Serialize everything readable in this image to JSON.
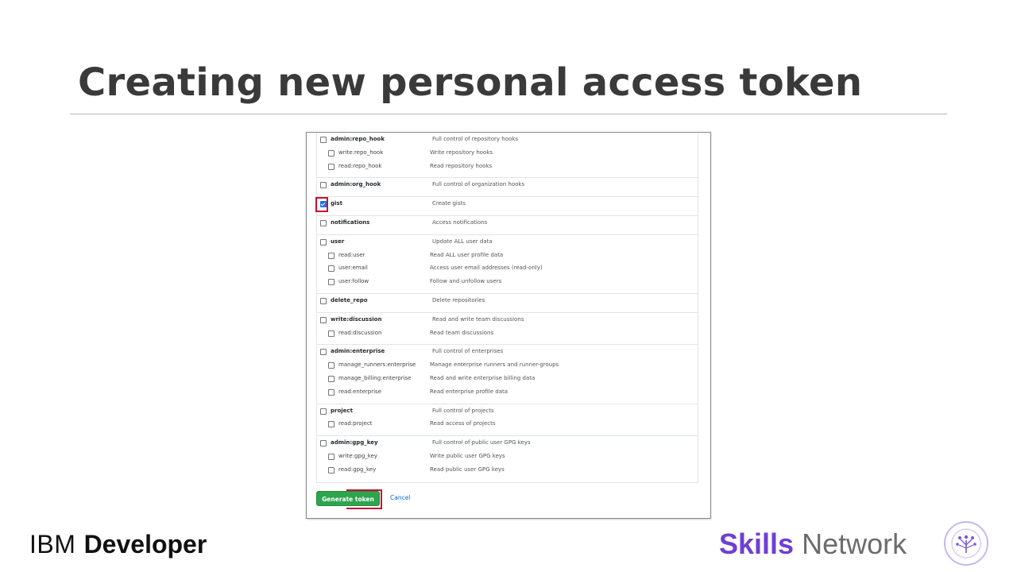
{
  "slide": {
    "title": "Creating new personal access token"
  },
  "scopes": {
    "groups": [
      {
        "rows": [
          {
            "name": "admin:repo_hook",
            "desc": "Full control of repository hooks",
            "level": "parent",
            "checked": false
          },
          {
            "name": "write:repo_hook",
            "desc": "Write repository hooks",
            "level": "child",
            "checked": false
          },
          {
            "name": "read:repo_hook",
            "desc": "Read repository hooks",
            "level": "child",
            "checked": false
          }
        ]
      },
      {
        "rows": [
          {
            "name": "admin:org_hook",
            "desc": "Full control of organization hooks",
            "level": "parent",
            "checked": false
          }
        ]
      },
      {
        "rows": [
          {
            "name": "gist",
            "desc": "Create gists",
            "level": "parent",
            "checked": true
          }
        ]
      },
      {
        "rows": [
          {
            "name": "notifications",
            "desc": "Access notifications",
            "level": "parent",
            "checked": false
          }
        ]
      },
      {
        "rows": [
          {
            "name": "user",
            "desc": "Update ALL user data",
            "level": "parent",
            "checked": false
          },
          {
            "name": "read:user",
            "desc": "Read ALL user profile data",
            "level": "child",
            "checked": false
          },
          {
            "name": "user:email",
            "desc": "Access user email addresses (read-only)",
            "level": "child",
            "checked": false
          },
          {
            "name": "user:follow",
            "desc": "Follow and unfollow users",
            "level": "child",
            "checked": false
          }
        ]
      },
      {
        "rows": [
          {
            "name": "delete_repo",
            "desc": "Delete repositories",
            "level": "parent",
            "checked": false
          }
        ]
      },
      {
        "rows": [
          {
            "name": "write:discussion",
            "desc": "Read and write team discussions",
            "level": "parent",
            "checked": false
          },
          {
            "name": "read:discussion",
            "desc": "Read team discussions",
            "level": "child",
            "checked": false
          }
        ]
      },
      {
        "rows": [
          {
            "name": "admin:enterprise",
            "desc": "Full control of enterprises",
            "level": "parent",
            "checked": false
          },
          {
            "name": "manage_runners:enterprise",
            "desc": "Manage enterprise runners and runner-groups",
            "level": "child",
            "checked": false
          },
          {
            "name": "manage_billing:enterprise",
            "desc": "Read and write enterprise billing data",
            "level": "child",
            "checked": false
          },
          {
            "name": "read:enterprise",
            "desc": "Read enterprise profile data",
            "level": "child",
            "checked": false
          }
        ]
      },
      {
        "rows": [
          {
            "name": "project",
            "desc": "Full control of projects",
            "level": "parent",
            "checked": false
          },
          {
            "name": "read:project",
            "desc": "Read access of projects",
            "level": "child",
            "checked": false
          }
        ]
      },
      {
        "rows": [
          {
            "name": "admin:gpg_key",
            "desc": "Full control of public user GPG keys",
            "level": "parent",
            "checked": false
          },
          {
            "name": "write:gpg_key",
            "desc": "Write public user GPG keys",
            "level": "child",
            "checked": false
          },
          {
            "name": "read:gpg_key",
            "desc": "Read public user GPG keys",
            "level": "child",
            "checked": false
          }
        ]
      }
    ]
  },
  "actions": {
    "generate_label": "Generate token",
    "cancel_label": "Cancel"
  },
  "branding": {
    "ibm_light": "IBM",
    "ibm_bold": "Developer",
    "skills": "Skills",
    "network": "Network",
    "logo_icon": "tree-icon",
    "accent_color": "#6f3fd6",
    "highlight_color": "#c8102e",
    "button_color": "#2ea44f"
  }
}
